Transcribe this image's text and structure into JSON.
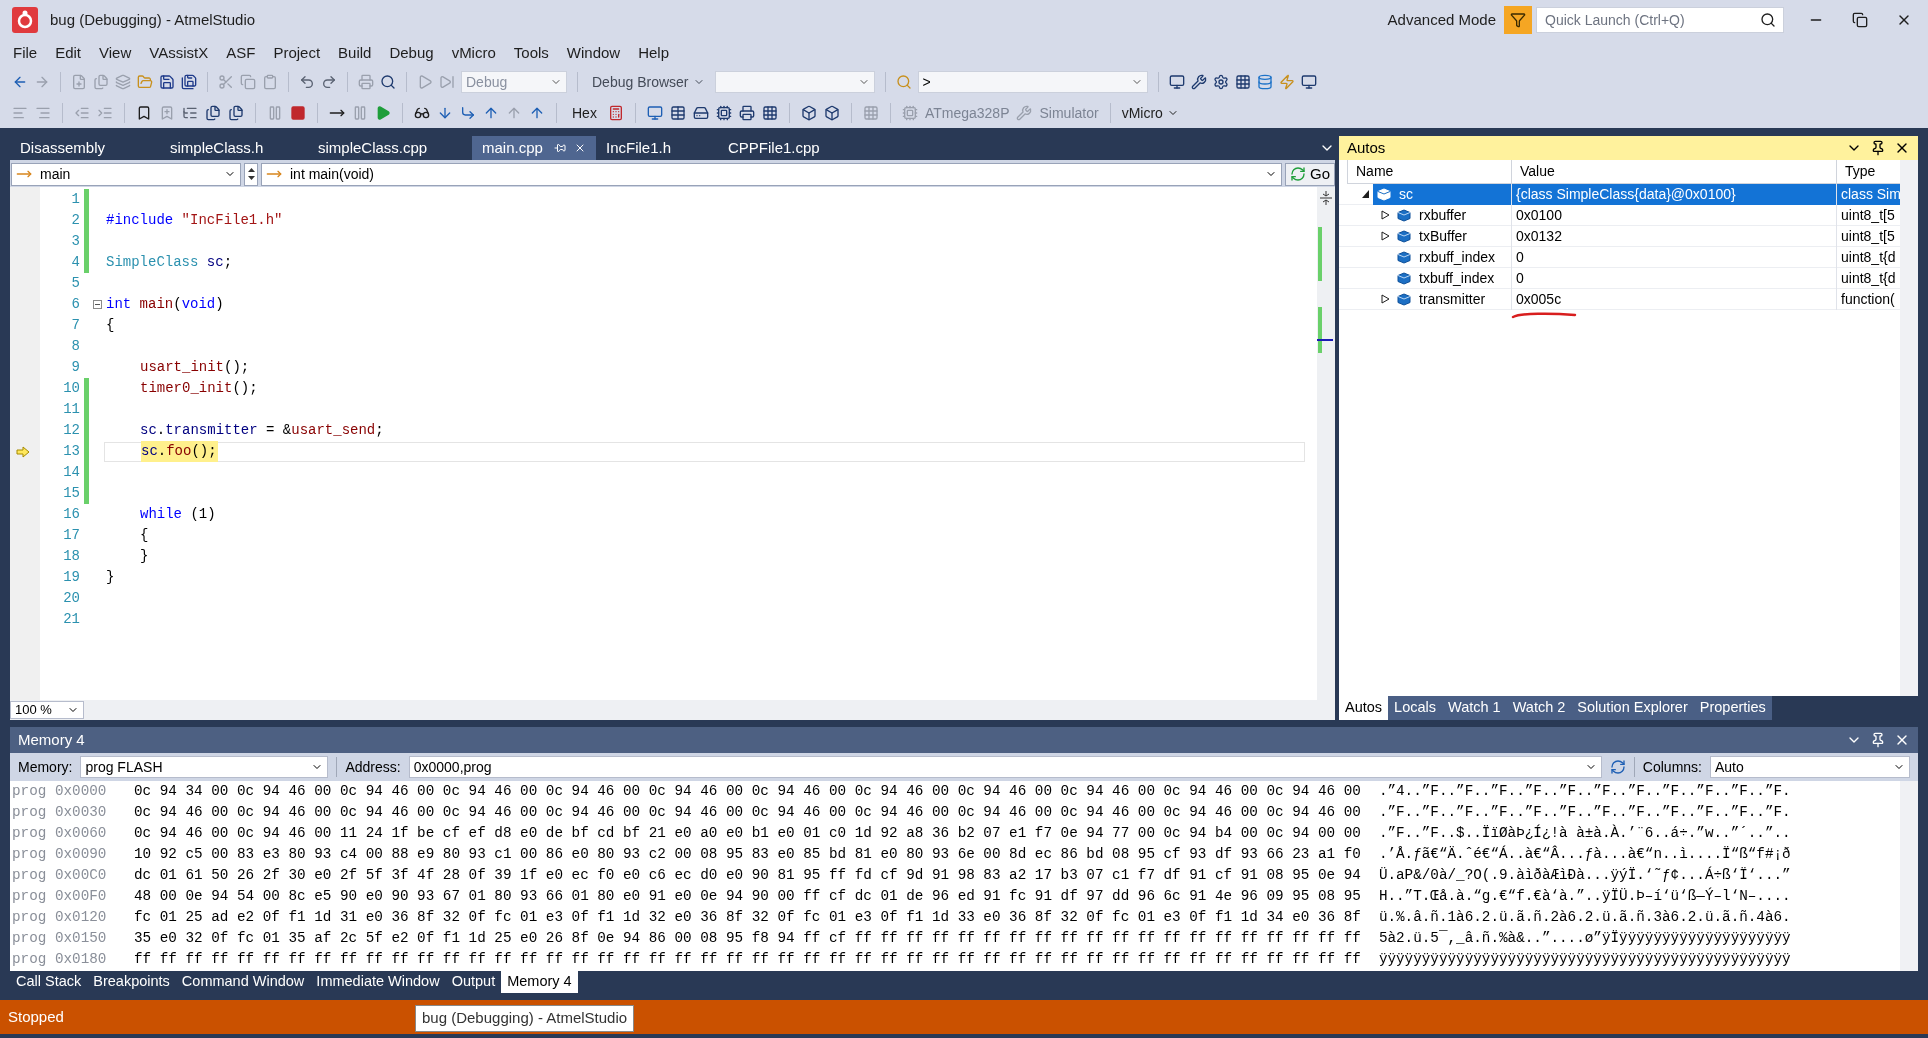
{
  "window": {
    "title": "bug (Debugging) - AtmelStudio",
    "mode": "Advanced Mode",
    "quick_launch": {
      "placeholder": "Quick Launch (Ctrl+Q)"
    }
  },
  "menu": [
    "File",
    "Edit",
    "View",
    "VAssistX",
    "ASF",
    "Project",
    "Build",
    "Debug",
    "vMicro",
    "Tools",
    "Window",
    "Help"
  ],
  "toolbar": {
    "config": "Debug",
    "debug_browser": "Debug Browser",
    "find_value": ">",
    "hex": "Hex",
    "device": "ATmega328P",
    "tool": "Simulator",
    "vmicro": "vMicro"
  },
  "editor": {
    "tabs": [
      {
        "label": "Disassembly",
        "selected": false,
        "pinned": false
      },
      {
        "label": "simpleClass.h",
        "selected": false,
        "pinned": false
      },
      {
        "label": "simpleClass.cpp",
        "selected": false,
        "pinned": false
      },
      {
        "label": "main.cpp",
        "selected": true,
        "pinned": true
      },
      {
        "label": "IncFile1.h",
        "selected": false,
        "pinned": false
      },
      {
        "label": "CPPFile1.cpp",
        "selected": false,
        "pinned": false
      }
    ],
    "scope": "main",
    "function": "int main(void)",
    "go": "Go",
    "zoom": "100 %",
    "lines": [
      {
        "number": "1",
        "modified": true,
        "current": false,
        "fold": false,
        "indented": false
      },
      {
        "number": "2",
        "modified": true,
        "current": false,
        "fold": false,
        "indented": false,
        "tokens": [
          {
            "text": "#include",
            "kind": "preproc"
          },
          {
            "text": " \"IncFile1.h\"",
            "kind": "string"
          }
        ]
      },
      {
        "number": "3",
        "modified": true,
        "current": false,
        "fold": false,
        "indented": false
      },
      {
        "number": "4",
        "modified": true,
        "current": false,
        "fold": false,
        "indented": false,
        "tokens": [
          {
            "text": "SimpleClass",
            "kind": "type"
          },
          {
            "text": " sc",
            "kind": "var"
          },
          {
            "text": ";",
            "kind": "plain"
          }
        ]
      },
      {
        "number": "5",
        "modified": false,
        "current": false,
        "fold": false,
        "indented": false
      },
      {
        "number": "6",
        "modified": false,
        "current": false,
        "fold": true,
        "indented": false,
        "tokens": [
          {
            "text": "int",
            "kind": "keyword"
          },
          {
            "text": " main",
            "kind": "func"
          },
          {
            "text": "(",
            "kind": "plain"
          },
          {
            "text": "void",
            "kind": "keyword"
          },
          {
            "text": ")",
            "kind": "plain"
          }
        ]
      },
      {
        "number": "7",
        "modified": false,
        "current": false,
        "fold": false,
        "indented": false,
        "tokens": [
          {
            "text": "{",
            "kind": "plain"
          }
        ]
      },
      {
        "number": "8",
        "modified": false,
        "current": false,
        "fold": false,
        "indented": false
      },
      {
        "number": "9",
        "modified": false,
        "current": false,
        "fold": false,
        "indented": true,
        "tokens": [
          {
            "text": "usart_init",
            "kind": "func"
          },
          {
            "text": "();",
            "kind": "plain"
          }
        ]
      },
      {
        "number": "10",
        "modified": true,
        "current": false,
        "fold": false,
        "indented": true,
        "tokens": [
          {
            "text": "timer0_init",
            "kind": "func"
          },
          {
            "text": "();",
            "kind": "plain"
          }
        ]
      },
      {
        "number": "11",
        "modified": true,
        "current": false,
        "fold": false,
        "indented": false
      },
      {
        "number": "12",
        "modified": true,
        "current": false,
        "fold": false,
        "indented": true,
        "tokens": [
          {
            "text": "sc",
            "kind": "var"
          },
          {
            "text": ".",
            "kind": "plain"
          },
          {
            "text": "transmitter",
            "kind": "var"
          },
          {
            "text": " = &",
            "kind": "plain"
          },
          {
            "text": "usart_send",
            "kind": "func"
          },
          {
            "text": ";",
            "kind": "plain"
          }
        ]
      },
      {
        "number": "13",
        "modified": true,
        "current": true,
        "fold": false,
        "indented": true,
        "tokens": [
          {
            "text": "sc",
            "kind": "var"
          },
          {
            "text": ".",
            "kind": "plain"
          },
          {
            "text": "foo",
            "kind": "func"
          },
          {
            "text": "();",
            "kind": "plain"
          }
        ]
      },
      {
        "number": "14",
        "modified": true,
        "current": false,
        "fold": false,
        "indented": false
      },
      {
        "number": "15",
        "modified": true,
        "current": false,
        "fold": false,
        "indented": false
      },
      {
        "number": "16",
        "modified": false,
        "current": false,
        "fold": false,
        "indented": true,
        "tokens": [
          {
            "text": "while",
            "kind": "keyword"
          },
          {
            "text": " (1)",
            "kind": "plain"
          }
        ]
      },
      {
        "number": "17",
        "modified": false,
        "current": false,
        "fold": false,
        "indented": true,
        "tokens": [
          {
            "text": "{",
            "kind": "plain"
          }
        ]
      },
      {
        "number": "18",
        "modified": false,
        "current": false,
        "fold": false,
        "indented": true,
        "tokens": [
          {
            "text": "}",
            "kind": "plain"
          }
        ]
      },
      {
        "number": "19",
        "modified": false,
        "current": false,
        "fold": false,
        "indented": false,
        "tokens": [
          {
            "text": "}",
            "kind": "plain"
          }
        ]
      },
      {
        "number": "20",
        "modified": false,
        "current": false,
        "fold": false,
        "indented": false
      },
      {
        "number": "21",
        "modified": false,
        "current": false,
        "fold": false,
        "indented": false
      }
    ]
  },
  "autos": {
    "title": "Autos",
    "columns": [
      "Name",
      "Value",
      "Type"
    ],
    "rows": [
      {
        "name": "sc",
        "value": "{class SimpleClass{data}@0x0100}",
        "type": "class Sim",
        "selected": true,
        "has_children": true,
        "expanded": true,
        "underlined": false,
        "children": [
          {
            "name": "rxbuffer",
            "value": "0x0100",
            "type": "uint8_t[5",
            "selected": false,
            "has_children": true,
            "expanded": false,
            "underlined": false
          },
          {
            "name": "txBuffer",
            "value": "0x0132",
            "type": "uint8_t[5",
            "selected": false,
            "has_children": true,
            "expanded": false,
            "underlined": false
          },
          {
            "name": "rxbuff_index",
            "value": "0",
            "type": "uint8_t{d",
            "selected": false,
            "has_children": false,
            "expanded": false,
            "underlined": false
          },
          {
            "name": "txbuff_index",
            "value": "0",
            "type": "uint8_t{d",
            "selected": false,
            "has_children": false,
            "expanded": false,
            "underlined": false
          },
          {
            "name": "transmitter",
            "value": "0x005c",
            "type": "function(",
            "selected": false,
            "has_children": true,
            "expanded": false,
            "underlined": true
          }
        ]
      }
    ],
    "tabs": [
      {
        "label": "Autos",
        "selected": true
      },
      {
        "label": "Locals",
        "selected": false
      },
      {
        "label": "Watch 1",
        "selected": false
      },
      {
        "label": "Watch 2",
        "selected": false
      },
      {
        "label": "Solution Explorer",
        "selected": false
      },
      {
        "label": "Properties",
        "selected": false
      }
    ]
  },
  "memory": {
    "title": "Memory 4",
    "memory_label": "Memory:",
    "memory_value": "prog FLASH",
    "address_label": "Address:",
    "address_value": "0x0000,prog",
    "columns_label": "Columns:",
    "columns_value": "Auto",
    "rows": [
      {
        "address": "prog 0x0000",
        "bytes": "0c 94 34 00 0c 94 46 00 0c 94 46 00 0c 94 46 00 0c 94 46 00 0c 94 46 00 0c 94 46 00 0c 94 46 00 0c 94 46 00 0c 94 46 00 0c 94 46 00 0c 94 46 00",
        "ascii": ".”4..”F..”F..”F..”F..”F..”F..”F..”F..”F..”F..”F."
      },
      {
        "address": "prog 0x0030",
        "bytes": "0c 94 46 00 0c 94 46 00 0c 94 46 00 0c 94 46 00 0c 94 46 00 0c 94 46 00 0c 94 46 00 0c 94 46 00 0c 94 46 00 0c 94 46 00 0c 94 46 00 0c 94 46 00",
        "ascii": ".”F..”F..”F..”F..”F..”F..”F..”F..”F..”F..”F..”F."
      },
      {
        "address": "prog 0x0060",
        "bytes": "0c 94 46 00 0c 94 46 00 11 24 1f be cf ef d8 e0 de bf cd bf 21 e0 a0 e0 b1 e0 01 c0 1d 92 a8 36 b2 07 e1 f7 0e 94 77 00 0c 94 b4 00 0c 94 00 00",
        "ascii": ".”F..”F..$..ÏïØàÞ¿Í¿!à à±à.À.’¨6..á÷.”w..”´..”.."
      },
      {
        "address": "prog 0x0090",
        "bytes": "10 92 c5 00 83 e3 80 93 c4 00 88 e9 80 93 c1 00 86 e0 80 93 c2 00 08 95 83 e0 85 bd 81 e0 80 93 6e 00 8d ec 86 bd 08 95 cf 93 df 93 66 23 a1 f0",
        "ascii": ".’Å.ƒã€“Ä.ˆé€“Á..à€“Â...ƒà...à€“n..ì....Ï“ß“f#¡ð"
      },
      {
        "address": "prog 0x00C0",
        "bytes": "dc 01 61 50 26 2f 30 e0 2f 5f 3f 4f 28 0f 39 1f e0 ec f0 e0 c6 ec d0 e0 90 81 95 ff fd cf 9d 91 98 83 a2 17 b3 07 c1 f7 df 91 cf 91 08 95 0e 94",
        "ascii": "Ü.aP&/0à/_?O(.9.àìðàÆìÐà...ÿýÏ.‘˜ƒ¢...Á÷ß‘Ï‘...”"
      },
      {
        "address": "prog 0x00F0",
        "bytes": "48 00 0e 94 54 00 8c e5 90 e0 90 93 67 01 80 93 66 01 80 e0 91 e0 0e 94 90 00 ff cf dc 01 de 96 ed 91 fc 91 df 97 dd 96 6c 91 4e 96 09 95 08 95",
        "ascii": "H..”T.Œå.à.“g.€“f.€à‘à.”..ÿÏÜ.Þ–í‘ü‘ß—Ý–l‘N–...."
      },
      {
        "address": "prog 0x0120",
        "bytes": "fc 01 25 ad e2 0f f1 1d 31 e0 36 8f 32 0f fc 01 e3 0f f1 1d 32 e0 36 8f 32 0f fc 01 e3 0f f1 1d 33 e0 36 8f 32 0f fc 01 e3 0f f1 1d 34 e0 36 8f",
        "ascii": "ü.%.â.ñ.1à6.2.ü.ã.ñ.2à6.2.ü.ã.ñ.3à6.2.ü.ã.ñ.4à6."
      },
      {
        "address": "prog 0x0150",
        "bytes": "35 e0 32 0f fc 01 35 af 2c 5f e2 0f f1 1d 25 e0 26 8f 0e 94 86 00 08 95 f8 94 ff cf ff ff ff ff ff ff ff ff ff ff ff ff ff ff ff ff ff ff ff ff",
        "ascii": "5à2.ü.5¯,_â.ñ.%à&..”....ø”ÿÏÿÿÿÿÿÿÿÿÿÿÿÿÿÿÿÿÿÿÿÿ"
      },
      {
        "address": "prog 0x0180",
        "bytes": "ff ff ff ff ff ff ff ff ff ff ff ff ff ff ff ff ff ff ff ff ff ff ff ff ff ff ff ff ff ff ff ff ff ff ff ff ff ff ff ff ff ff ff ff ff ff ff ff",
        "ascii": "ÿÿÿÿÿÿÿÿÿÿÿÿÿÿÿÿÿÿÿÿÿÿÿÿÿÿÿÿÿÿÿÿÿÿÿÿÿÿÿÿÿÿÿÿÿÿÿÿ"
      }
    ]
  },
  "bottom_tabs": [
    {
      "label": "Call Stack",
      "selected": false
    },
    {
      "label": "Breakpoints",
      "selected": false
    },
    {
      "label": "Command Window",
      "selected": false
    },
    {
      "label": "Immediate Window",
      "selected": false
    },
    {
      "label": "Output",
      "selected": false
    },
    {
      "label": "Memory 4",
      "selected": true
    }
  ],
  "status_bar": {
    "text": "Stopped",
    "tooltip": "bug (Debugging) - AtmelStudio"
  }
}
